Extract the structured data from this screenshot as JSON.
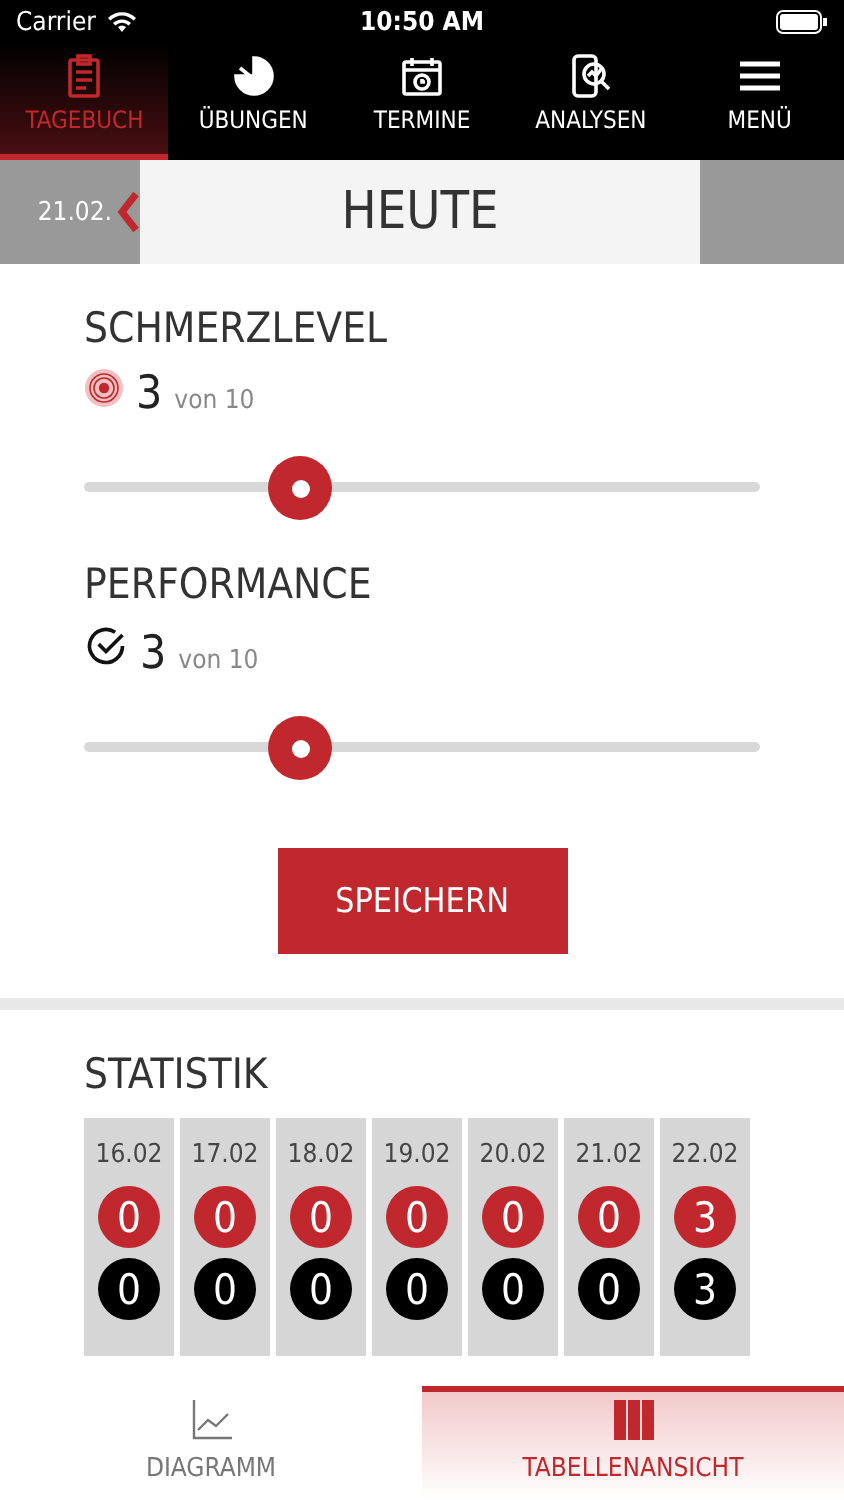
{
  "status_bar": {
    "carrier": "Carrier",
    "time": "10:50 AM"
  },
  "nav": [
    {
      "label": "TAGEBUCH",
      "kind": "clipboard",
      "selected": true
    },
    {
      "label": "ÜBUNGEN",
      "kind": "pie",
      "selected": false
    },
    {
      "label": "TERMINE",
      "kind": "calendar",
      "selected": false
    },
    {
      "label": "ANALYSEN",
      "kind": "analysis",
      "selected": false
    },
    {
      "label": "MENÜ",
      "kind": "menu",
      "selected": false
    }
  ],
  "date_bar": {
    "previous": "21.02.",
    "title": "HEUTE"
  },
  "ratings": [
    {
      "title": "SCHMERZLEVEL",
      "kind": "pain",
      "value": "3",
      "scale": "von 10",
      "level": 0.32
    },
    {
      "title": "PERFORMANCE",
      "kind": "performance",
      "value": "3",
      "scale": "von 10",
      "level": 0.32
    }
  ],
  "save_button": "SPEICHERN",
  "statistics": {
    "title": "STATISTIK",
    "days": [
      {
        "date": "16.02",
        "pain": "0",
        "performance": "0"
      },
      {
        "date": "17.02",
        "pain": "0",
        "performance": "0"
      },
      {
        "date": "18.02",
        "pain": "0",
        "performance": "0"
      },
      {
        "date": "19.02",
        "pain": "0",
        "performance": "0"
      },
      {
        "date": "20.02",
        "pain": "0",
        "performance": "0"
      },
      {
        "date": "21.02",
        "pain": "0",
        "performance": "0"
      },
      {
        "date": "22.02",
        "pain": "3",
        "performance": "3"
      }
    ]
  },
  "bottom_tabs": [
    {
      "label": "DIAGRAMM",
      "kind": "chart",
      "selected": false
    },
    {
      "label": "TABELLENANSICHT",
      "kind": "table",
      "selected": true
    }
  ]
}
